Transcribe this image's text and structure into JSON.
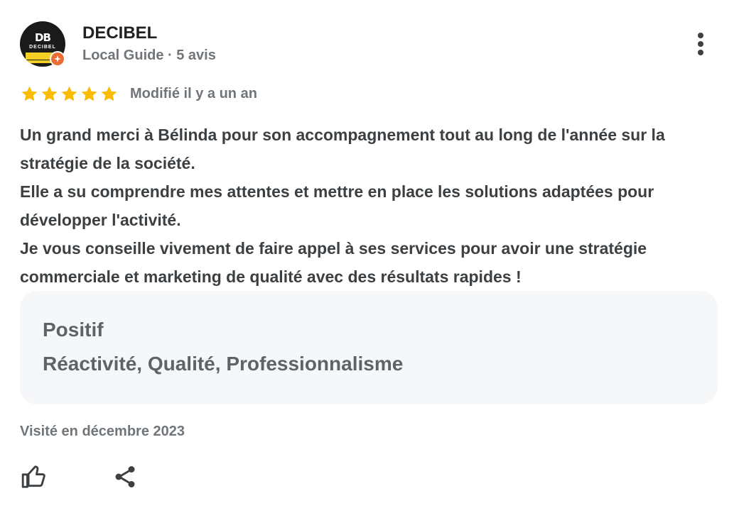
{
  "author": {
    "name": "DECIBEL",
    "meta": "Local Guide · 5 avis",
    "avatar_logo": "DB",
    "avatar_brand": "DECIBEL"
  },
  "rating": {
    "stars": 5,
    "max": 5,
    "edited": "Modifié il y a un an"
  },
  "review": {
    "paragraphs": [
      "Un grand merci à Bélinda pour son accompagnement tout au long de l'année sur la stratégie de la société.",
      "Elle a su comprendre mes attentes et mettre en place les solutions adaptées pour développer l'activité.",
      "Je vous conseille vivement de faire appel à ses services pour avoir une stratégie commerciale et marketing de qualité avec des résultats rapides !"
    ]
  },
  "highlights": {
    "title": "Positif",
    "value": "Réactivité, Qualité, Professionnalisme"
  },
  "visited": "Visité en décembre 2023",
  "icons": {
    "more": "more-vertical-icon",
    "like": "thumbs-up-icon",
    "share": "share-icon",
    "badge": "local-guide-badge-icon",
    "star": "star-icon"
  },
  "colors": {
    "star": "#fbbc04",
    "badge": "#ea6d35",
    "text": "#3c4043",
    "muted": "#70757a",
    "highlight_bg": "#f6f7f9"
  }
}
